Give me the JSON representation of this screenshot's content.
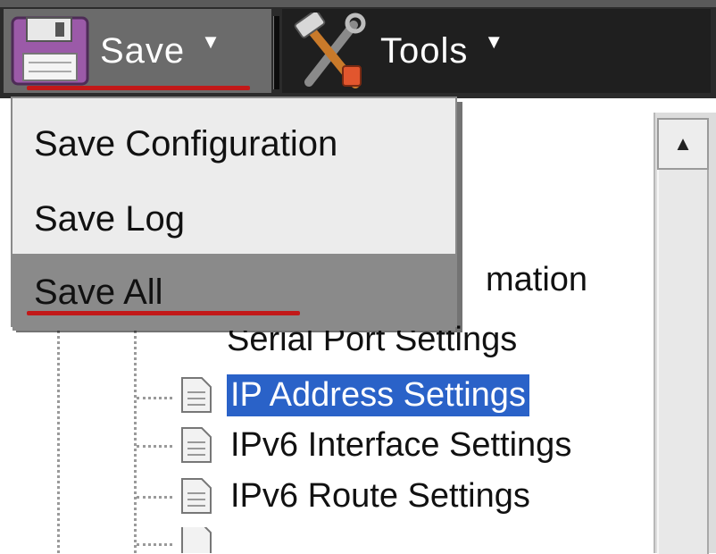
{
  "toolbar": {
    "save_label": "Save",
    "tools_label": "Tools",
    "save_icon": "floppy-disk-icon",
    "tools_icon": "hammer-wrench-icon"
  },
  "save_menu": {
    "items": [
      {
        "label": "Save Configuration"
      },
      {
        "label": "Save Log"
      },
      {
        "label": "Save All",
        "active": true
      }
    ]
  },
  "tree": {
    "items": [
      {
        "label": "mation",
        "partial": true
      },
      {
        "label": "Serial Port Settings",
        "partial": true
      },
      {
        "label": "IP Address Settings",
        "selected": true
      },
      {
        "label": "IPv6 Interface Settings"
      },
      {
        "label": "IPv6 Route Settings"
      }
    ]
  },
  "colors": {
    "toolbar_bg": "#2b2b2b",
    "highlight_blue": "#2a62c8",
    "annotation_red": "#c21818",
    "menu_active": "#8a8a8a"
  }
}
